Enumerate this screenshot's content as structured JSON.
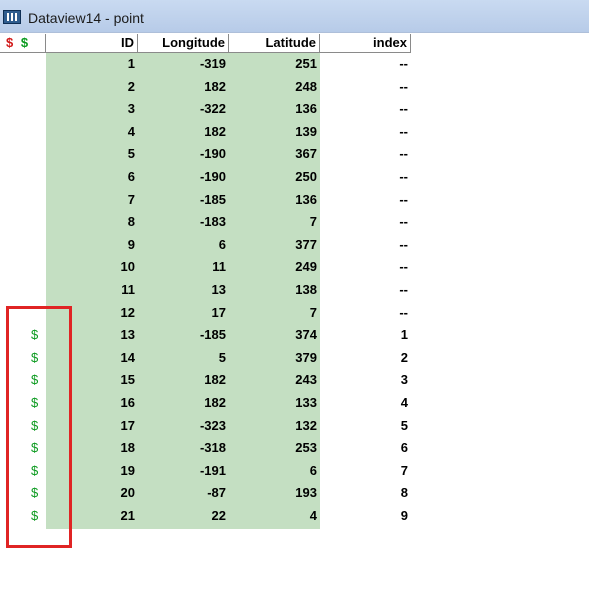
{
  "window": {
    "title": "Dataview14 - point",
    "icon": "table-icon"
  },
  "columns": {
    "selection_red": "$",
    "selection_green": "$",
    "id": "ID",
    "longitude": "Longitude",
    "latitude": "Latitude",
    "index": "index"
  },
  "rows": [
    {
      "sel": "",
      "id": "1",
      "lon": "-319",
      "lat": "251",
      "idx": "--"
    },
    {
      "sel": "",
      "id": "2",
      "lon": "182",
      "lat": "248",
      "idx": "--"
    },
    {
      "sel": "",
      "id": "3",
      "lon": "-322",
      "lat": "136",
      "idx": "--"
    },
    {
      "sel": "",
      "id": "4",
      "lon": "182",
      "lat": "139",
      "idx": "--"
    },
    {
      "sel": "",
      "id": "5",
      "lon": "-190",
      "lat": "367",
      "idx": "--"
    },
    {
      "sel": "",
      "id": "6",
      "lon": "-190",
      "lat": "250",
      "idx": "--"
    },
    {
      "sel": "",
      "id": "7",
      "lon": "-185",
      "lat": "136",
      "idx": "--"
    },
    {
      "sel": "",
      "id": "8",
      "lon": "-183",
      "lat": "7",
      "idx": "--"
    },
    {
      "sel": "",
      "id": "9",
      "lon": "6",
      "lat": "377",
      "idx": "--"
    },
    {
      "sel": "",
      "id": "10",
      "lon": "11",
      "lat": "249",
      "idx": "--"
    },
    {
      "sel": "",
      "id": "11",
      "lon": "13",
      "lat": "138",
      "idx": "--"
    },
    {
      "sel": "",
      "id": "12",
      "lon": "17",
      "lat": "7",
      "idx": "--"
    },
    {
      "sel": "$",
      "id": "13",
      "lon": "-185",
      "lat": "374",
      "idx": "1"
    },
    {
      "sel": "$",
      "id": "14",
      "lon": "5",
      "lat": "379",
      "idx": "2"
    },
    {
      "sel": "$",
      "id": "15",
      "lon": "182",
      "lat": "243",
      "idx": "3"
    },
    {
      "sel": "$",
      "id": "16",
      "lon": "182",
      "lat": "133",
      "idx": "4"
    },
    {
      "sel": "$",
      "id": "17",
      "lon": "-323",
      "lat": "132",
      "idx": "5"
    },
    {
      "sel": "$",
      "id": "18",
      "lon": "-318",
      "lat": "253",
      "idx": "6"
    },
    {
      "sel": "$",
      "id": "19",
      "lon": "-191",
      "lat": "6",
      "idx": "7"
    },
    {
      "sel": "$",
      "id": "20",
      "lon": "-87",
      "lat": "193",
      "idx": "8"
    },
    {
      "sel": "$",
      "id": "21",
      "lon": "22",
      "lat": "4",
      "idx": "9"
    }
  ],
  "colors": {
    "selected_fill": "#c4dfc2",
    "marker_green": "#0a9a1e",
    "marker_red": "#d11818",
    "annotation_box": "#e02424"
  }
}
